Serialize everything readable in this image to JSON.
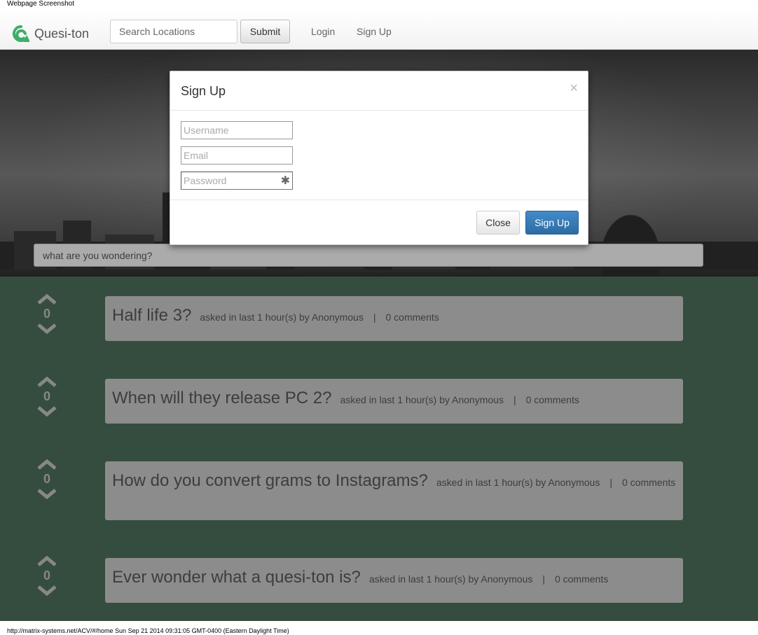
{
  "page_caption": "Webpage Screenshot",
  "navbar": {
    "brand": "Quesi-ton",
    "search_placeholder": "Search Locations",
    "submit_label": "Submit",
    "login_label": "Login",
    "signup_label": "Sign Up",
    "logo_color": "#3fae6a"
  },
  "hero": {
    "question_placeholder": "what are you wondering?"
  },
  "questions": [
    {
      "votes": "0",
      "title": "Half life 3?",
      "meta": "asked in last 1 hour(s) by Anonymous",
      "separator": "|",
      "comments": "0 comments"
    },
    {
      "votes": "0",
      "title": "When will they release PC 2?",
      "meta": "asked in last 1 hour(s) by Anonymous",
      "separator": "|",
      "comments": "0 comments"
    },
    {
      "votes": "0",
      "title": "How do you convert grams to Instagrams?",
      "meta": "asked in last 1 hour(s) by Anonymous",
      "separator": "|",
      "comments": "0 comments"
    },
    {
      "votes": "0",
      "title": "Ever wonder what a quesi-ton is?",
      "meta": "asked in last 1 hour(s) by Anonymous",
      "separator": "|",
      "comments": "0 comments"
    }
  ],
  "modal": {
    "title": "Sign Up",
    "close_x": "×",
    "username_placeholder": "Username",
    "email_placeholder": "Email",
    "password_placeholder": "Password",
    "password_icon": "✱",
    "close_label": "Close",
    "submit_label": "Sign Up"
  },
  "footer_url": "http://matrix-systems.net/ACV/#/home Sun Sep 21 2014 09:31:05 GMT-0400 (Eastern Daylight Time)"
}
